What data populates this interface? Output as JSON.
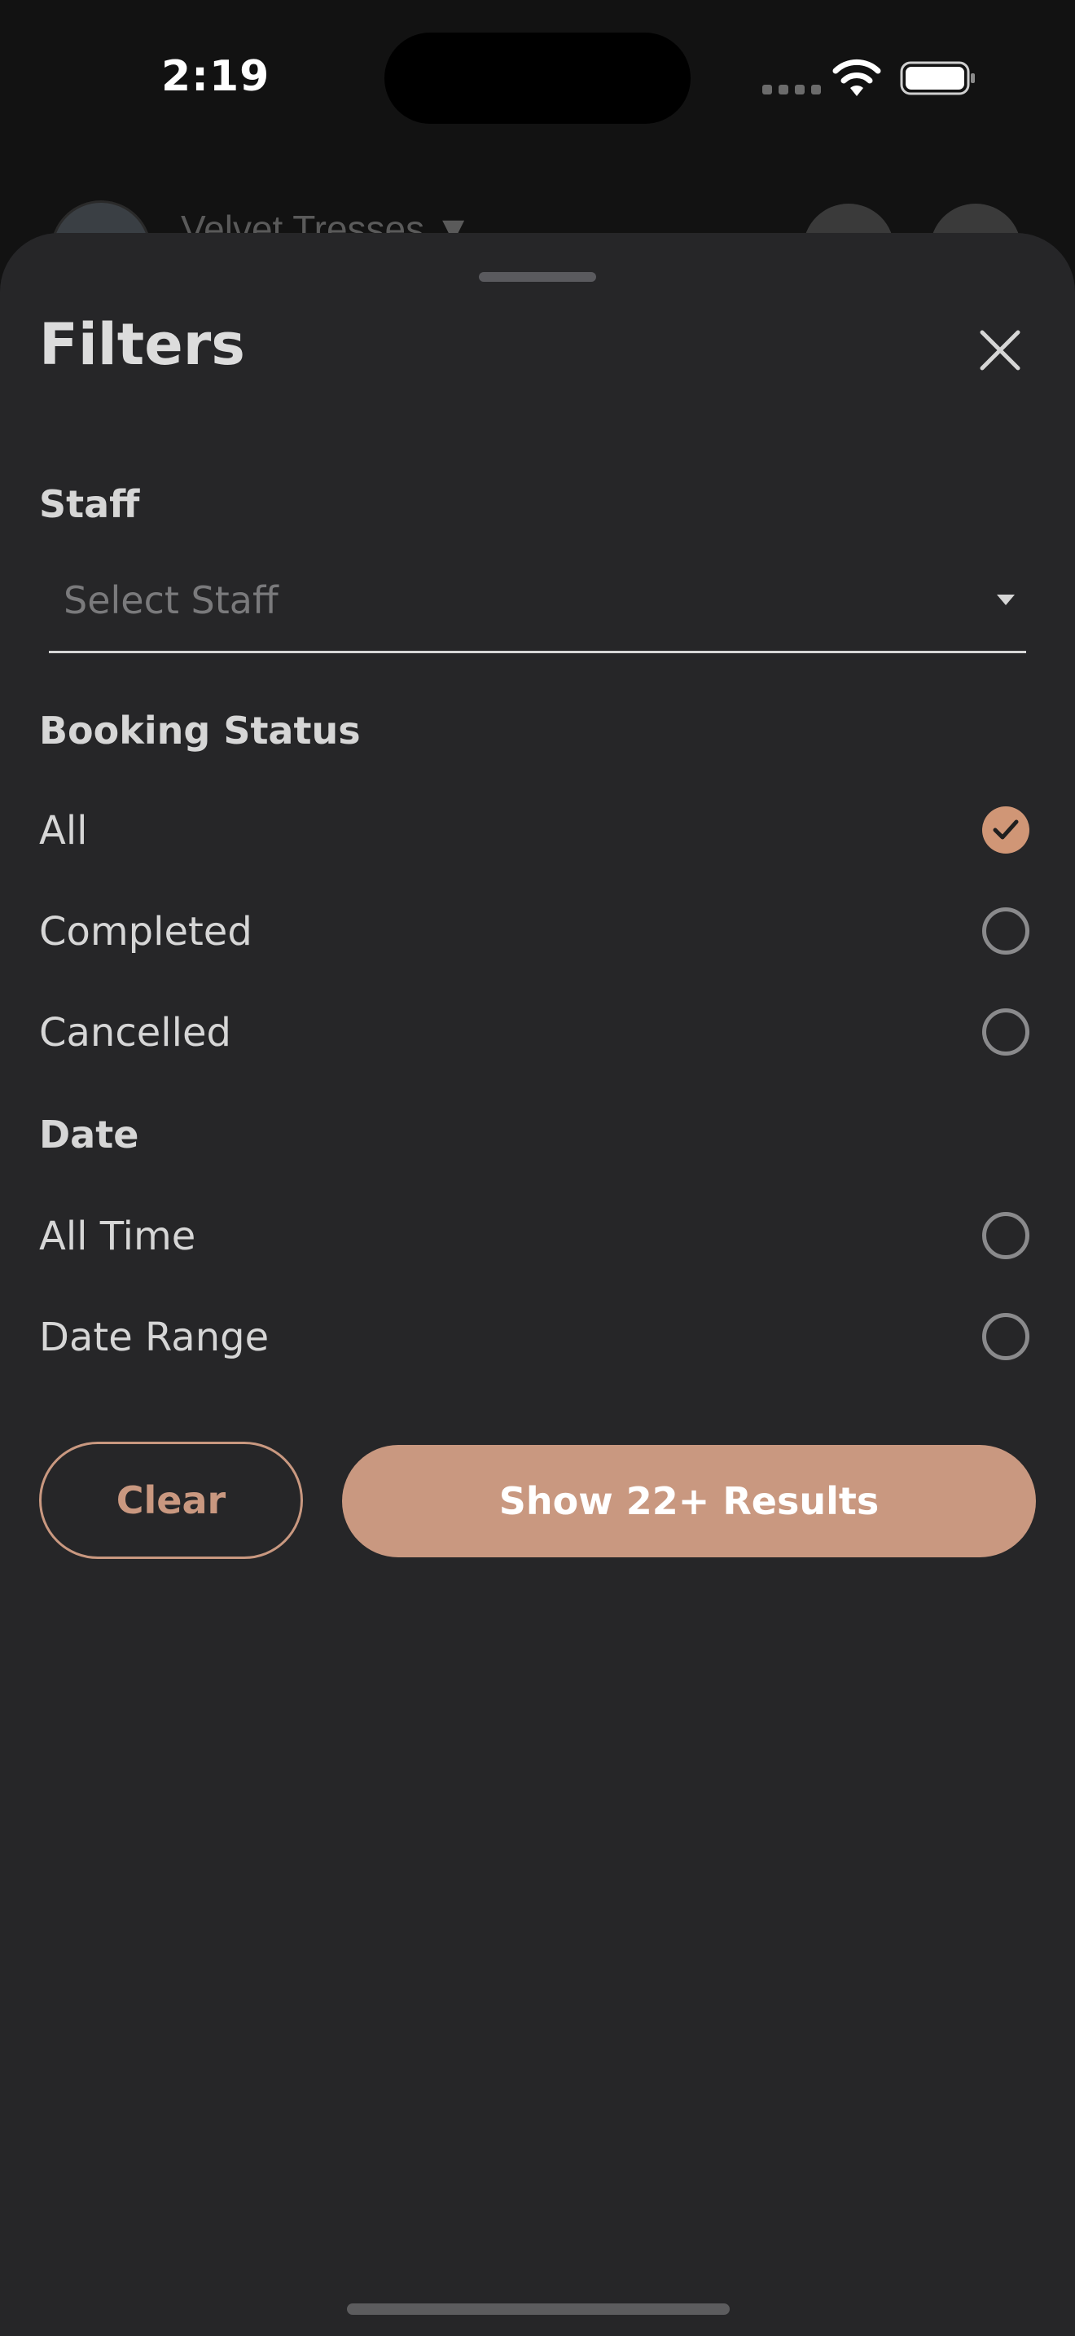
{
  "status_bar": {
    "time": "2:19"
  },
  "background_app": {
    "title": "Velvet Tresses ▼"
  },
  "sheet": {
    "title": "Filters",
    "close_icon": "close-icon",
    "staff": {
      "label": "Staff",
      "placeholder": "Select Staff"
    },
    "booking_status": {
      "label": "Booking Status",
      "options": [
        {
          "label": "All",
          "selected": true
        },
        {
          "label": "Completed",
          "selected": false
        },
        {
          "label": "Cancelled",
          "selected": false
        }
      ]
    },
    "date": {
      "label": "Date",
      "options": [
        {
          "label": "All Time",
          "selected": false
        },
        {
          "label": "Date Range",
          "selected": false
        }
      ]
    },
    "buttons": {
      "clear": "Clear",
      "show": "Show 22+ Results"
    }
  },
  "colors": {
    "accent": "#c99880",
    "sheet_bg": "#262628",
    "text": "#d6d6d6"
  }
}
